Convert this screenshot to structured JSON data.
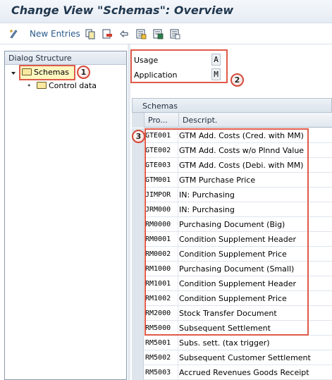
{
  "window": {
    "title": "Change View \"Schemas\": Overview"
  },
  "toolbar": {
    "new_entries_label": "New Entries"
  },
  "dialog_structure": {
    "header": "Dialog Structure",
    "items": [
      {
        "label": "Schemas",
        "selected": true
      },
      {
        "label": "Control data",
        "selected": false
      }
    ]
  },
  "fields": {
    "usage": {
      "label": "Usage",
      "value": "A"
    },
    "application": {
      "label": "Application",
      "value": "M"
    }
  },
  "schemas_table": {
    "title": "Schemas",
    "columns": [
      "Pro...",
      "Descript."
    ],
    "rows": [
      {
        "code": "GTE001",
        "description": "GTM Add. Costs (Cred. with MM)"
      },
      {
        "code": "GTE002",
        "description": "GTM Add. Costs w/o Plnnd Value"
      },
      {
        "code": "GTE003",
        "description": "GTM Add. Costs (Debi. with MM)"
      },
      {
        "code": "GTM001",
        "description": "GTM Purchase Price"
      },
      {
        "code": "JIMPOR",
        "description": "IN: Purchasing"
      },
      {
        "code": "JRM000",
        "description": "IN: Purchasing"
      },
      {
        "code": "RM0000",
        "description": "Purchasing Document (Big)"
      },
      {
        "code": "RM0001",
        "description": "Condition Supplement Header"
      },
      {
        "code": "RM0002",
        "description": "Condition Supplement Price"
      },
      {
        "code": "RM1000",
        "description": "Purchasing Document (Small)"
      },
      {
        "code": "RM1001",
        "description": "Condition Supplement Header"
      },
      {
        "code": "RM1002",
        "description": "Condition Supplement Price"
      },
      {
        "code": "RM2000",
        "description": "Stock Transfer Document"
      },
      {
        "code": "RM5000",
        "description": "Subsequent Settlement"
      },
      {
        "code": "RM5001",
        "description": "Subs. sett. (tax trigger)"
      },
      {
        "code": "RM5002",
        "description": "Subsequent Customer Settlement"
      },
      {
        "code": "RM5003",
        "description": "Accrued Revenues Goods Receipt"
      }
    ]
  },
  "callouts": [
    "1",
    "2",
    "3"
  ],
  "colors": {
    "callout_border": "#e05a4a",
    "title_text": "#21384f",
    "selected_item_bg": "#fff7c0"
  }
}
